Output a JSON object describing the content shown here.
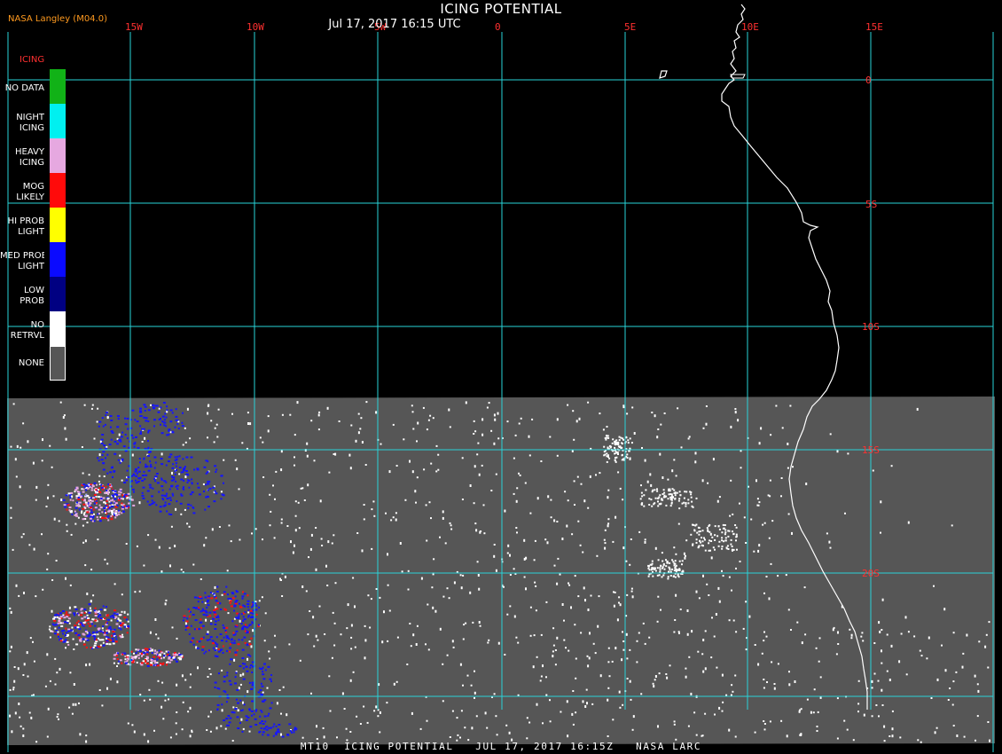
{
  "header": {
    "title": "ICING POTENTIAL",
    "subtitle": "Jul 17, 2017 16:15 UTC",
    "producer": "NASA Langley (M04.0)"
  },
  "footer": {
    "caption": "MT10  ICING POTENTIAL   JUL 17, 2017 16:15Z   NASA LARC"
  },
  "grid": {
    "longitudes": [
      "15W",
      "10W",
      "5W",
      "0",
      "5E",
      "10E",
      "15E"
    ],
    "latitudes": [
      "0",
      "5S",
      "10S",
      "15S",
      "20S"
    ],
    "color": "#29d3d8"
  },
  "legend": {
    "title": "ICING",
    "items": [
      {
        "label": "NO DATA",
        "color": "#11b217"
      },
      {
        "label": "NIGHT\nICING",
        "color": "#00f0f0"
      },
      {
        "label": "HEAVY\nICING",
        "color": "#e6a8e0"
      },
      {
        "label": "MOG\nLIKELY",
        "color": "#ff0a0a"
      },
      {
        "label": "HI PROB\nLIGHT",
        "color": "#ffff00"
      },
      {
        "label": "MED PROB\nLIGHT",
        "color": "#0a0aff"
      },
      {
        "label": "LOW\nPROB",
        "color": "#000082"
      },
      {
        "label": "NO\nRETRVL",
        "color": "#ffffff"
      },
      {
        "label": "NONE",
        "color": "#565656"
      }
    ]
  },
  "map": {
    "night_region_color": "#000000",
    "day_region_color": "#565656",
    "coastline_color": "#ffffff"
  }
}
